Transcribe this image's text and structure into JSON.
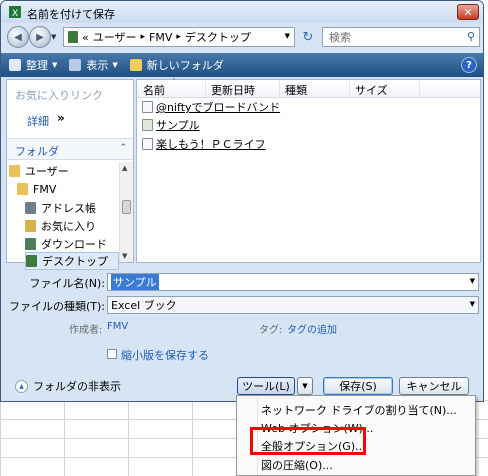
{
  "window": {
    "title": "名前を付けて保存",
    "close_glyph": "✕"
  },
  "address_bar": {
    "segments": [
      "ユーザー",
      "FMV",
      "デスクトップ"
    ],
    "prefix": "«",
    "separator": "▸"
  },
  "search": {
    "placeholder": "検索",
    "icon": "search-icon"
  },
  "toolbar": {
    "organize": "整理",
    "views": "表示",
    "new_folder": "新しいフォルダ",
    "help_glyph": "?"
  },
  "left_pane": {
    "favorites_title": "お気に入りリンク",
    "details_link": "詳細",
    "details_chevron": "»",
    "folders_label": "フォルダ",
    "folders_chevron": "⌃",
    "tree": [
      {
        "label": "ユーザー",
        "selected": false
      },
      {
        "label": "FMV",
        "selected": false
      },
      {
        "label": "アドレス帳",
        "selected": false
      },
      {
        "label": "お気に入り",
        "selected": false
      },
      {
        "label": "ダウンロード",
        "selected": false
      },
      {
        "label": "デスクトップ",
        "selected": true
      }
    ]
  },
  "file_list": {
    "columns": [
      "名前",
      "更新日時",
      "種類",
      "サイズ"
    ],
    "files": [
      {
        "name": "@niftyでブロードバンド"
      },
      {
        "name": "サンプル"
      },
      {
        "name": "楽しもう！ＰＣライフ"
      }
    ]
  },
  "form": {
    "filename_label": "ファイル名(N):",
    "filename_value": "サンプル",
    "filetype_label": "ファイルの種類(T):",
    "filetype_value": "Excel ブック",
    "author_label": "作成者:",
    "author_value": "FMV",
    "tags_label": "タグ:",
    "tags_value": "タグの追加",
    "thumbnail_label": "縮小版を保存する",
    "thumbnail_checked": false
  },
  "footer": {
    "hide_folders": "フォルダの非表示",
    "tools": "ツール(L)",
    "save": "保存(S)",
    "cancel": "キャンセル"
  },
  "tools_menu": {
    "items": [
      "ネットワーク ドライブの割り当て(N)...",
      "Web オプション(W)...",
      "全般オプション(G)...",
      "図の圧縮(O)..."
    ],
    "highlighted_index": 2,
    "highlight_color": "#ff0000"
  },
  "colors": {
    "toolbar_bg": "#1d4f85",
    "link": "#1e5bb8",
    "selection": "#3a7bd5"
  }
}
